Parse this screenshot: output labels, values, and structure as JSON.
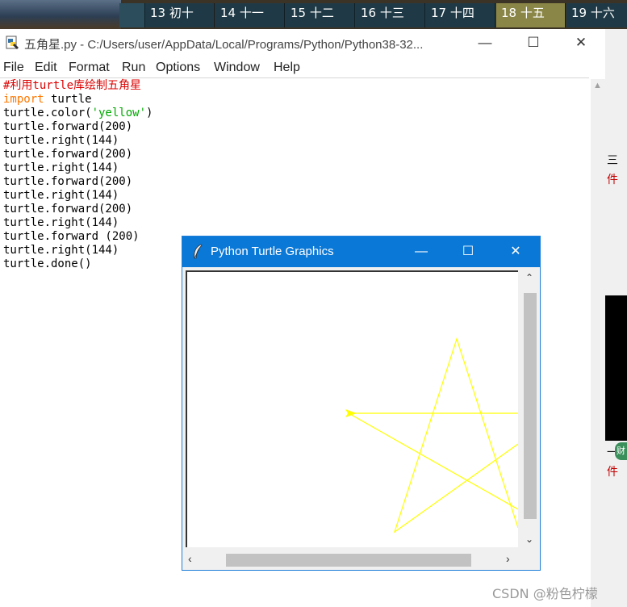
{
  "calendar": {
    "days": [
      {
        "label": "13 初十",
        "today": false
      },
      {
        "label": "14 十一",
        "today": false
      },
      {
        "label": "15 十二",
        "today": false
      },
      {
        "label": "16 十三",
        "today": false
      },
      {
        "label": "17 十四",
        "today": false
      },
      {
        "label": "18 十五",
        "today": true
      },
      {
        "label": "19 十六",
        "today": false
      }
    ]
  },
  "side_fragments": {
    "g1": "三",
    "r1": "件",
    "g2": "一",
    "badge": "财",
    "r2": "件"
  },
  "idle": {
    "title": "五角星.py - C:/Users/user/AppData/Local/Programs/Python/Python38-32...",
    "controls": {
      "minimize": "—",
      "maximize": "☐",
      "close": "✕"
    },
    "menu": [
      "File",
      "Edit",
      "Format",
      "Run",
      "Options",
      "Window",
      "Help"
    ],
    "code": {
      "comment": "#利用turtle库绘制五角星",
      "import_kw": "import",
      "import_rest": " turtle",
      "color_pre": "turtle.color(",
      "color_str": "'yellow'",
      "color_post": ")",
      "lines": [
        "turtle.forward(200)",
        "turtle.right(144)",
        "turtle.forward(200)",
        "turtle.right(144)",
        "turtle.forward(200)",
        "turtle.right(144)",
        "turtle.forward(200)",
        "turtle.right(144)",
        "turtle.forward (200)",
        "turtle.right(144)",
        "turtle.done()"
      ]
    }
  },
  "turtle_window": {
    "title": "Python Turtle Graphics",
    "controls": {
      "minimize": "—",
      "maximize": "☐",
      "close": "✕"
    },
    "pen_color": "#ffff00",
    "cursor_icon": "turtle-arrow-icon"
  },
  "watermark": "CSDN @粉色柠檬"
}
